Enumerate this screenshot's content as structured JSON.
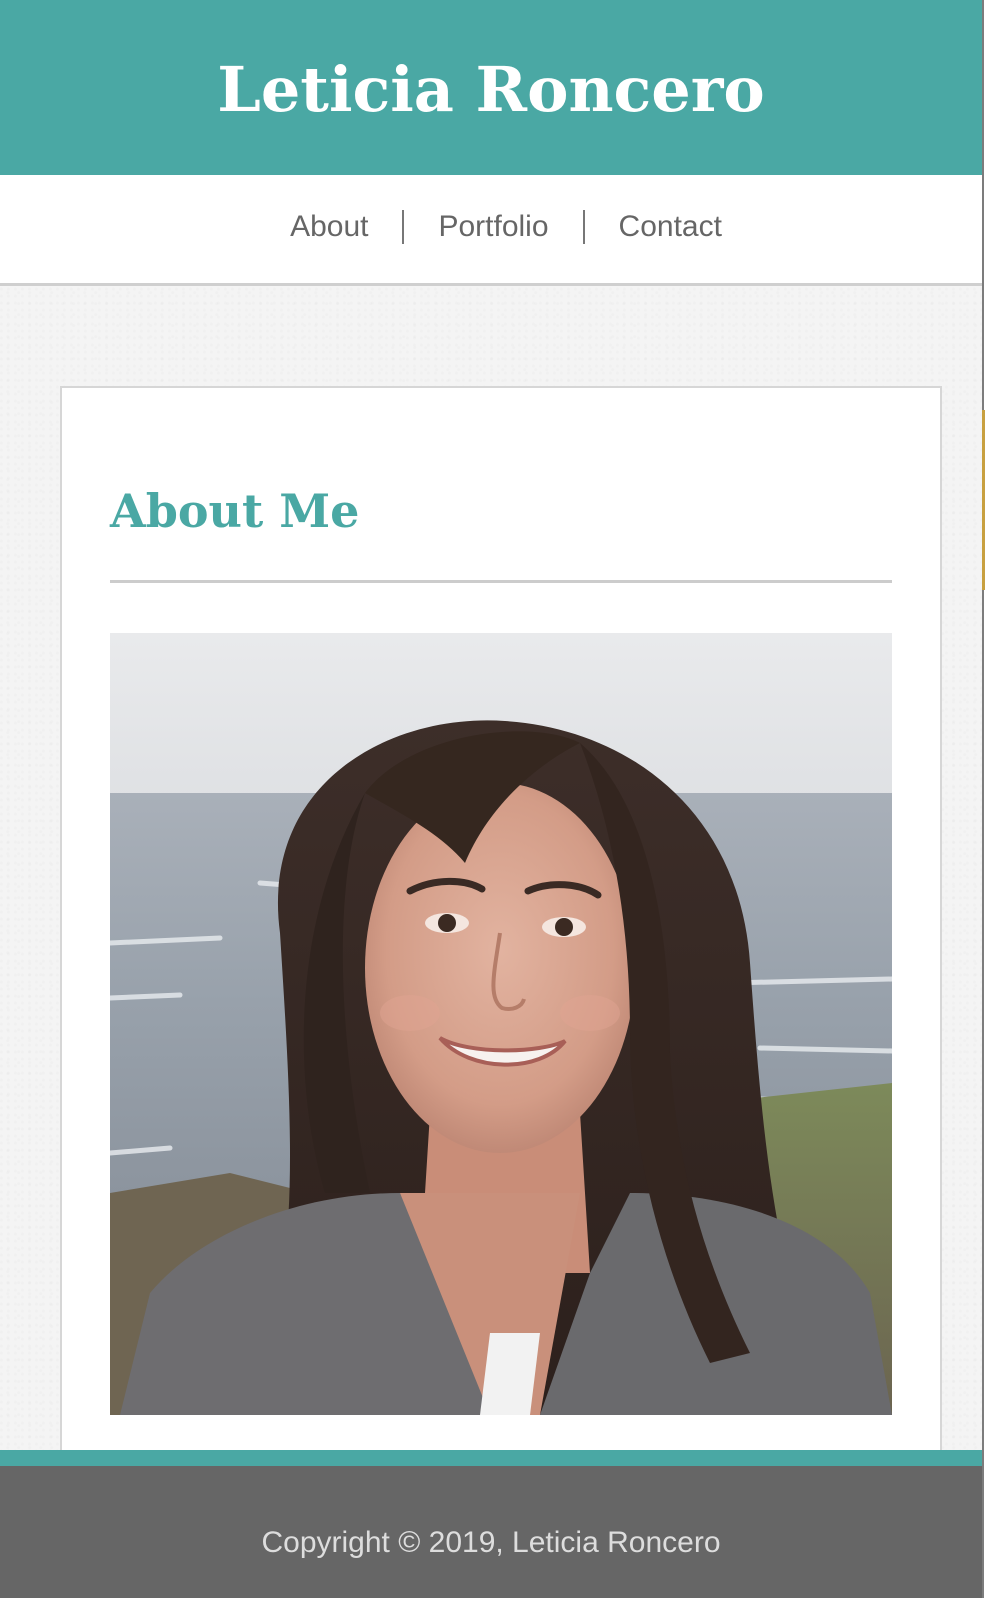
{
  "site": {
    "title": "Leticia Roncero"
  },
  "nav": {
    "items": [
      {
        "label": "About"
      },
      {
        "label": "Portfolio"
      },
      {
        "label": "Contact"
      }
    ]
  },
  "main": {
    "heading": "About Me",
    "photo": {
      "subject": "portrait-photo"
    }
  },
  "footer": {
    "copyright": "Copyright © 2019, Leticia Roncero"
  },
  "colors": {
    "accent": "#4aa8a4",
    "header_bg": "#4aa8a4",
    "footer_bg": "#666666",
    "nav_text": "#666666",
    "card_bg": "#ffffff"
  }
}
